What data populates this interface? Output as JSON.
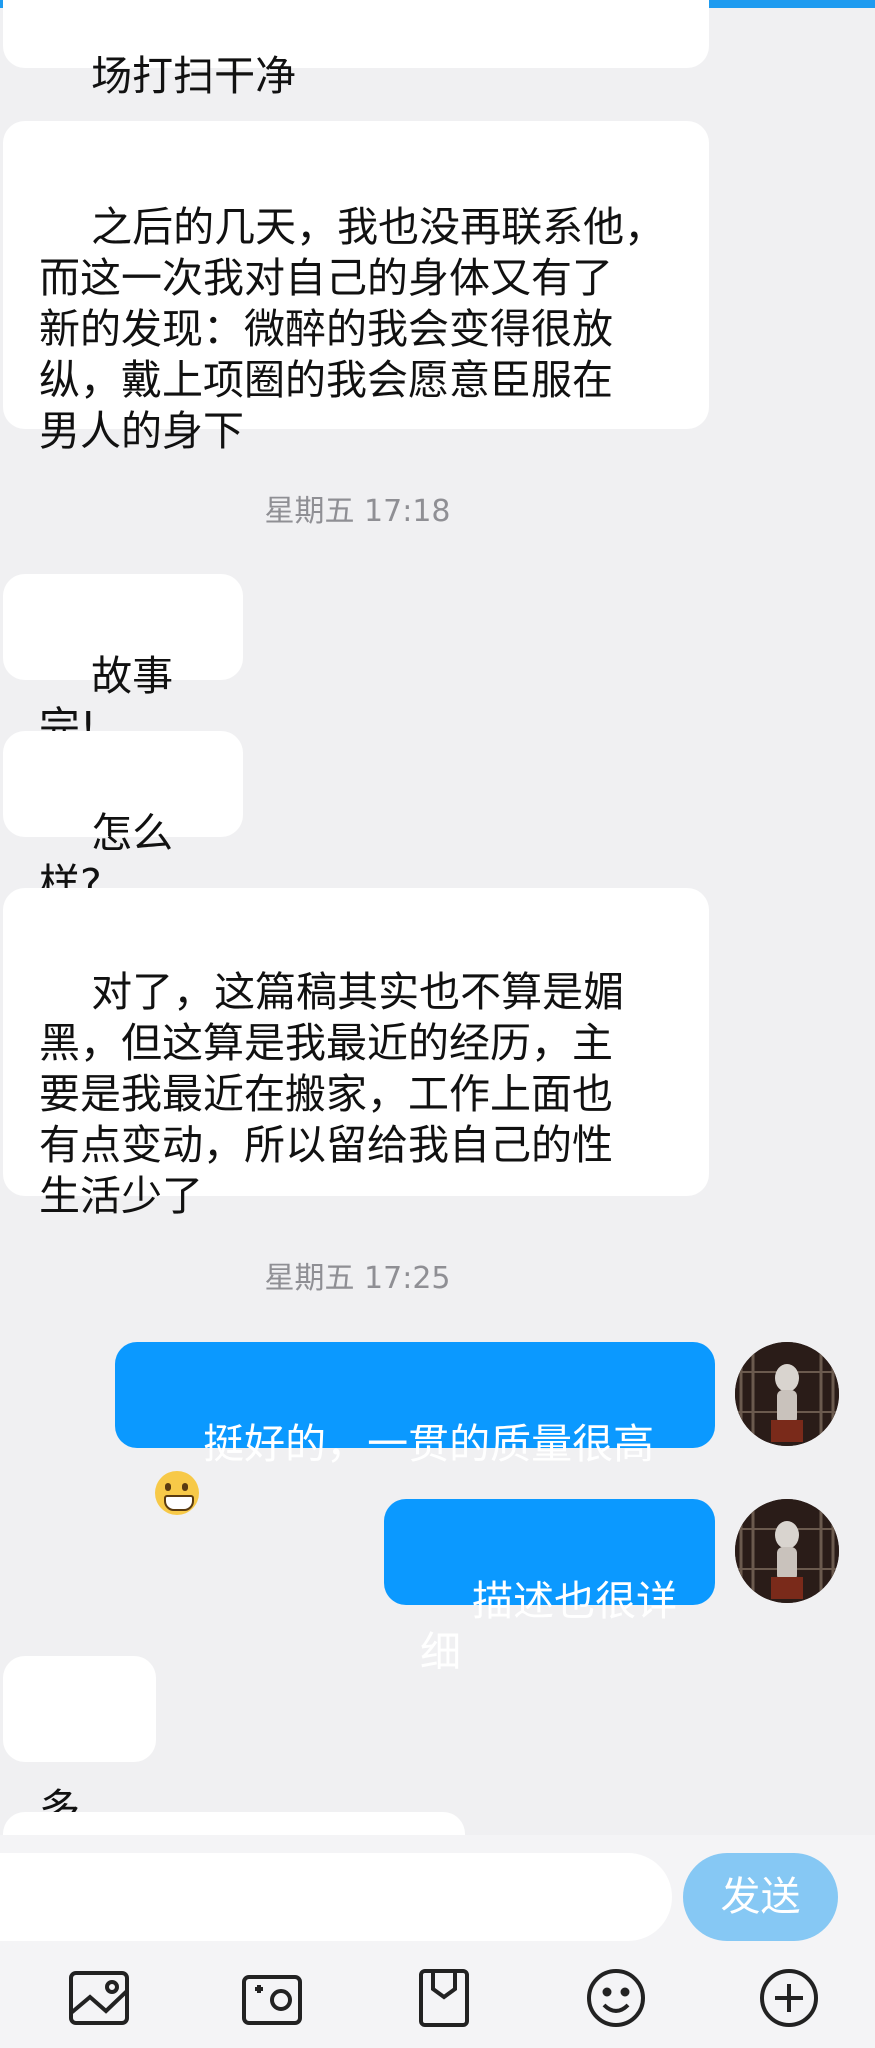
{
  "messages": [
    {
      "side": "in",
      "text": "场打扫干净"
    },
    {
      "side": "in",
      "text": "之后的几天，我也没再联系他，\n而这一次我对自己的身体又有了\n新的发现：微醉的我会变得很放\n纵，戴上项圈的我会愿意臣服在\n男人的身下"
    },
    {
      "type": "time",
      "text": "星期五 17:18"
    },
    {
      "side": "in",
      "text": "故事完!"
    },
    {
      "side": "in",
      "text": "怎么样?"
    },
    {
      "side": "in",
      "text": "对了，这篇稿其实也不算是媚\n黑，但这算是我最近的经历，主\n要是我最近在搬家，工作上面也\n有点变动，所以留给我自己的性\n生活少了"
    },
    {
      "type": "time",
      "text": "星期五 17:25"
    },
    {
      "side": "out",
      "text": "挺好的，一贯的质量很高",
      "emoji": "grinning-face"
    },
    {
      "side": "out",
      "text": "描述也很详细"
    },
    {
      "side": "in",
      "text": "多谢"
    }
  ],
  "input": {
    "placeholder": ""
  },
  "send_label": "发送",
  "toolbar": [
    "image-icon",
    "camera-icon",
    "file-icon",
    "emoji-icon",
    "plus-circle-icon"
  ],
  "colors": {
    "accent": "#0b99ff",
    "send_disabled": "#86c8f4",
    "background": "#f0f0f2"
  }
}
